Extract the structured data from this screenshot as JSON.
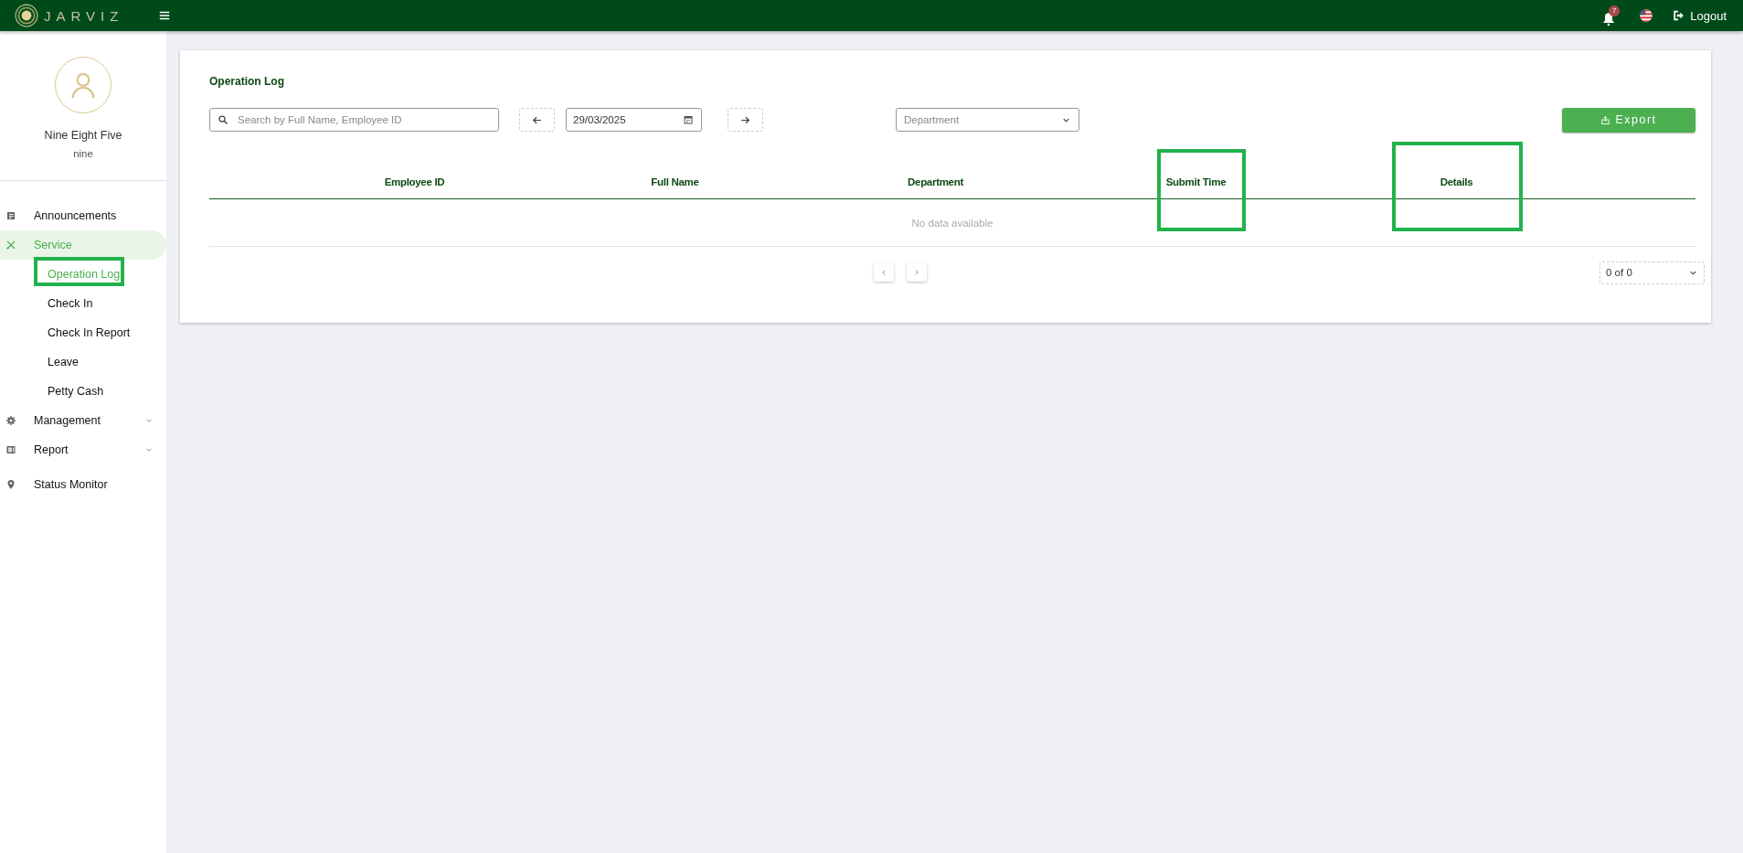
{
  "topbar": {
    "brand": "JARVIZ",
    "notification_count": "7",
    "logout": "Logout"
  },
  "user": {
    "name": "Nine Eight Five",
    "username": "nine"
  },
  "sidebar": {
    "items": [
      {
        "label": "Announcements",
        "kind": "list",
        "selected": false
      },
      {
        "label": "Service",
        "kind": "tools",
        "selected": true,
        "children": [
          {
            "label": "Operation Log",
            "selected": true,
            "highlighted": true
          },
          {
            "label": "Check In",
            "selected": false,
            "highlighted": false
          },
          {
            "label": "Check In Report",
            "selected": false,
            "highlighted": false
          },
          {
            "label": "Leave",
            "selected": false,
            "highlighted": false
          },
          {
            "label": "Petty Cash",
            "selected": false,
            "highlighted": false
          }
        ]
      },
      {
        "label": "Management",
        "kind": "gear",
        "selected": false,
        "expanded": false
      },
      {
        "label": "Report",
        "kind": "report",
        "selected": false,
        "expanded": false
      },
      {
        "label": "Status Monitor",
        "kind": "pin",
        "selected": false
      }
    ]
  },
  "page": {
    "title": "Operation Log",
    "search": {
      "placeholder": "Search by Full Name, Employee ID"
    },
    "date": "29/03/2025",
    "department": {
      "placeholder": "Department"
    },
    "export": "Export",
    "columns": [
      {
        "label": "Employee ID",
        "highlighted": false
      },
      {
        "label": "Full Name",
        "highlighted": false
      },
      {
        "label": "Department",
        "highlighted": false
      },
      {
        "label": "Submit Time",
        "highlighted": true
      },
      {
        "label": "Details",
        "highlighted": true
      }
    ],
    "empty_text": "No data available",
    "pagination": "0 of 0"
  }
}
